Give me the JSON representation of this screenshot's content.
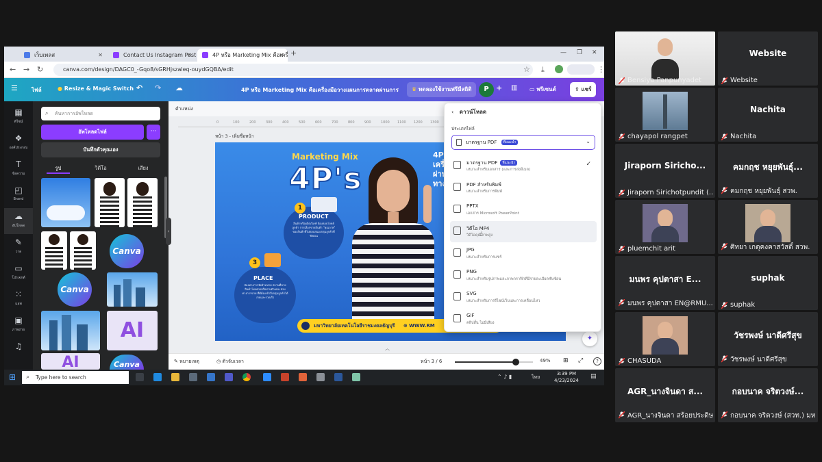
{
  "browser": {
    "tabs": [
      {
        "label": "เว็บเพลส"
      },
      {
        "label": "Contact Us Instagram Post - 1080..."
      },
      {
        "label": "4P หรือ Marketing Mix คือเครื่อง..."
      }
    ],
    "url": "canva.com/design/DAGC0_-Gqo8/sGRHjszaleq-ouydGQBA/edit"
  },
  "canva": {
    "menu_file": "ไฟล์",
    "resize": "Resize & Magic Switch",
    "doc_title": "4P หรือ Marketing Mix คือเครื่องมือวางแผนการตลาดผ่านการวิเ...",
    "try_pro": "ทดลองใช้งานฟรีมีสถิติ",
    "avatar_letter": "P",
    "present": "พรีเซนต์",
    "share": "แชร์"
  },
  "rail": [
    {
      "label": "ดีไซน์",
      "icon": "design-icon"
    },
    {
      "label": "องค์ประกอบ",
      "icon": "elements-icon"
    },
    {
      "label": "ข้อความ",
      "icon": "text-icon"
    },
    {
      "label": "Brand",
      "icon": "brand-icon"
    },
    {
      "label": "อัปโหลด",
      "icon": "upload-icon"
    },
    {
      "label": "วาด",
      "icon": "draw-icon"
    },
    {
      "label": "โปรเจกต์",
      "icon": "projects-icon"
    },
    {
      "label": "แอพ",
      "icon": "apps-icon"
    },
    {
      "label": "ภาพถ่าย",
      "icon": "photos-icon"
    },
    {
      "label": "",
      "icon": "audio-icon"
    }
  ],
  "panel": {
    "search_placeholder": "ค้นหาการอัพโหลด",
    "upload": "อัพโหลดไฟล์",
    "more": "···",
    "record": "บันทึกตัวคุณเอง",
    "tabs": [
      "รูป",
      "วิดีโอ",
      "เสียง"
    ],
    "thumb_canva": "Canva",
    "thumb_ai": "AI"
  },
  "editor": {
    "position_label": "ตำแหน่ง",
    "page_label": "หน้า 3 - เพิ่มชื่อหน้า",
    "ruler_ticks": [
      "0",
      "100",
      "200",
      "300",
      "400",
      "500",
      "600",
      "700",
      "800",
      "900",
      "1000",
      "1100",
      "1200",
      "1300"
    ],
    "design": {
      "title_small": "Marketing Mix",
      "title_big": "4P's",
      "product_num": "1",
      "product_title": "PRODUCT",
      "product_body": "สินค้าหรือผลิตภัณฑ์ ต้องตอบโจทย์ลูกค้า การเลือกขายสินค้า \"คุณภาพ\" ของสินค้าที่ไปตอบสนองกลุ่มลูกค้าที่ชัดเจน",
      "place_num": "3",
      "place_title": "PLACE",
      "place_body": "ช่องทางการจัดจำหน่าย สถานที่ขายสินค้าโดยตรงหรือผ่านตัวแทน ช่องทางการขาย ที่ดีต้องเข้าถึงกลุ่มลูกค้าได้ง่ายและรวดเร็ว",
      "side_text_1": "4P ห",
      "side_text_2": "เครื่อ",
      "side_text_3": "ผ่าน",
      "side_text_4": "ทางก",
      "footer": "มหาวิทยาลัยเทคโนโลยีราชมงคลธัญบุรี",
      "footer_url": "WWW.RM"
    },
    "notes": "หมายเหตุ",
    "timer": "ตัวจับเวลา",
    "page_counter": "หน้า 3 / 6",
    "zoom": "49%",
    "zoom_fraction": 0.49,
    "help": "?"
  },
  "download": {
    "back_title": "ดาวน์โหลด",
    "file_type_label": "ประเภทไฟล์",
    "selected": "มาตรฐาน PDF",
    "selected_badge": "ที่แนะนำ",
    "options": [
      {
        "name": "มาตรฐาน PDF",
        "badge": "ที่แนะนำ",
        "desc": "เหมาะสำหรับเอกสาร (และการส่งอีเมล)",
        "icon": "pdf-icon",
        "checked": true
      },
      {
        "name": "PDF สำหรับพิมพ์",
        "badge": "",
        "desc": "เหมาะสำหรับการพิมพ์",
        "icon": "pdf-print-icon",
        "checked": false
      },
      {
        "name": "PPTX",
        "badge": "",
        "desc": "เอกสาร Microsoft PowerPoint",
        "icon": "pptx-icon",
        "checked": false
      },
      {
        "name": "วิดีโอ MP4",
        "badge": "",
        "desc": "วิดีโอคุณภาพสูง",
        "icon": "video-icon",
        "checked": false
      },
      {
        "name": "JPG",
        "badge": "",
        "desc": "เหมาะสำหรับการแชร์",
        "icon": "jpg-icon",
        "checked": false
      },
      {
        "name": "PNG",
        "badge": "",
        "desc": "เหมาะสำหรับรูปภาพและภาพกราฟิกที่มีรายละเอียดซับซ้อน",
        "icon": "png-icon",
        "checked": false
      },
      {
        "name": "SVG",
        "badge": "",
        "desc": "เหมาะสำหรับการรีไซน์เว็บและการเคลื่อนไหว",
        "icon": "svg-icon",
        "checked": false
      },
      {
        "name": "GIF",
        "badge": "",
        "desc": "คลิปสั้น ไม่มีเสียง",
        "icon": "gif-icon",
        "checked": false
      }
    ]
  },
  "taskbar": {
    "search_placeholder": "Type here to search",
    "time": "3:39 PM",
    "date": "4/23/2024",
    "lang": "ไทย"
  },
  "participants": [
    {
      "label": "Bensiya Panpunyadet",
      "name": "",
      "photo": true,
      "active": true,
      "color": "#7a6a5a"
    },
    {
      "label": "Website",
      "name": "Website",
      "photo": false
    },
    {
      "label": "chayapol rangpet",
      "name": "",
      "photo": true,
      "color": "#8aa0b8"
    },
    {
      "label": "Nachita",
      "name": "Nachita",
      "photo": false
    },
    {
      "label": "Jiraporn Sirichotpundit (...",
      "name": "Jiraporn Siricho...",
      "photo": false
    },
    {
      "label": "คมกฤช หยุยพันธุ์ สวพ.",
      "name": "คมกฤช หยุยพันธุ์...",
      "photo": false
    },
    {
      "label": "pluemchit arit",
      "name": "",
      "photo": true,
      "color": "#6f6a8c"
    },
    {
      "label": "ศิทยา เกตุคงคาสวัสดิ์ สวพ.",
      "name": "",
      "photo": true,
      "color": "#b8a894"
    },
    {
      "label": "มนพร คุปตาสา EN@RMU...",
      "name": "มนพร คุปตาสา E...",
      "photo": false
    },
    {
      "label": "suphak",
      "name": "suphak",
      "photo": false
    },
    {
      "label": "CHASUDA",
      "name": "",
      "photo": true,
      "color": "#c9a38a"
    },
    {
      "label": "วัชรพงษ์ นาดีศรีสุข",
      "name": "วัชรพงษ์ นาดีศรีสุข",
      "photo": false
    },
    {
      "label": "AGR_นางจินดา สร้อยประดิษฐ",
      "name": "AGR_นางจินดา ส...",
      "photo": false
    },
    {
      "label": "กอบนาค จริตวงษ์ (สวท.) มห...",
      "name": "กอบนาค จริตวงษ์...",
      "photo": false
    }
  ]
}
